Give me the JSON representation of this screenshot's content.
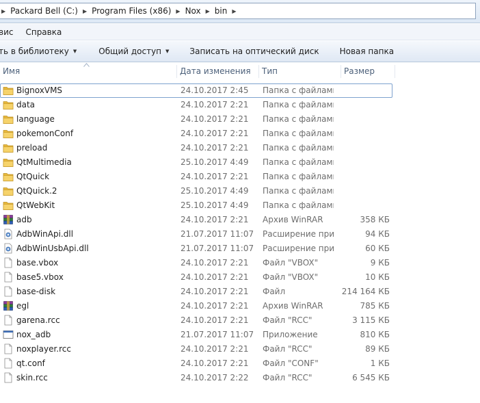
{
  "address": {
    "crumbs": [
      "Packard Bell (C:)",
      "Program Files (x86)",
      "Nox",
      "bin"
    ]
  },
  "menubar": {
    "items": [
      "вис",
      "Справка"
    ]
  },
  "toolbar": {
    "library_label": "ть в библиотеку",
    "share_label": "Общий доступ",
    "burn_label": "Записать на оптический диск",
    "new_folder_label": "Новая папка"
  },
  "columns": {
    "name": "Имя",
    "date": "Дата изменения",
    "type": "Тип",
    "size": "Размер"
  },
  "files": [
    {
      "name": "BignoxVMS",
      "date": "24.10.2017 2:45",
      "type": "Папка с файлами",
      "size": "",
      "icon": "folder-icon"
    },
    {
      "name": "data",
      "date": "24.10.2017 2:21",
      "type": "Папка с файлами",
      "size": "",
      "icon": "folder-icon"
    },
    {
      "name": "language",
      "date": "24.10.2017 2:21",
      "type": "Папка с файлами",
      "size": "",
      "icon": "folder-icon"
    },
    {
      "name": "pokemonConf",
      "date": "24.10.2017 2:21",
      "type": "Папка с файлами",
      "size": "",
      "icon": "folder-icon"
    },
    {
      "name": "preload",
      "date": "24.10.2017 2:21",
      "type": "Папка с файлами",
      "size": "",
      "icon": "folder-icon"
    },
    {
      "name": "QtMultimedia",
      "date": "25.10.2017 4:49",
      "type": "Папка с файлами",
      "size": "",
      "icon": "folder-icon"
    },
    {
      "name": "QtQuick",
      "date": "24.10.2017 2:21",
      "type": "Папка с файлами",
      "size": "",
      "icon": "folder-icon"
    },
    {
      "name": "QtQuick.2",
      "date": "25.10.2017 4:49",
      "type": "Папка с файлами",
      "size": "",
      "icon": "folder-icon"
    },
    {
      "name": "QtWebKit",
      "date": "25.10.2017 4:49",
      "type": "Папка с файлами",
      "size": "",
      "icon": "folder-icon"
    },
    {
      "name": "adb",
      "date": "24.10.2017 2:21",
      "type": "Архив WinRAR",
      "size": "358 КБ",
      "icon": "winrar-icon"
    },
    {
      "name": "AdbWinApi.dll",
      "date": "21.07.2017 11:07",
      "type": "Расширение при...",
      "size": "94 КБ",
      "icon": "dll-icon"
    },
    {
      "name": "AdbWinUsbApi.dll",
      "date": "21.07.2017 11:07",
      "type": "Расширение при...",
      "size": "60 КБ",
      "icon": "dll-icon"
    },
    {
      "name": "base.vbox",
      "date": "24.10.2017 2:21",
      "type": "Файл \"VBOX\"",
      "size": "9 КБ",
      "icon": "file-icon"
    },
    {
      "name": "base5.vbox",
      "date": "24.10.2017 2:21",
      "type": "Файл \"VBOX\"",
      "size": "10 КБ",
      "icon": "file-icon"
    },
    {
      "name": "base-disk",
      "date": "24.10.2017 2:21",
      "type": "Файл",
      "size": "214 164 КБ",
      "icon": "file-icon"
    },
    {
      "name": "egl",
      "date": "24.10.2017 2:21",
      "type": "Архив WinRAR",
      "size": "785 КБ",
      "icon": "winrar-icon"
    },
    {
      "name": "garena.rcc",
      "date": "24.10.2017 2:21",
      "type": "Файл \"RCC\"",
      "size": "3 115 КБ",
      "icon": "file-icon"
    },
    {
      "name": "nox_adb",
      "date": "21.07.2017 11:07",
      "type": "Приложение",
      "size": "810 КБ",
      "icon": "exe-icon"
    },
    {
      "name": "noxplayer.rcc",
      "date": "24.10.2017 2:21",
      "type": "Файл \"RCC\"",
      "size": "89 КБ",
      "icon": "file-icon"
    },
    {
      "name": "qt.conf",
      "date": "24.10.2017 2:21",
      "type": "Файл \"CONF\"",
      "size": "1 КБ",
      "icon": "file-icon"
    },
    {
      "name": "skin.rcc",
      "date": "24.10.2017 2:22",
      "type": "Файл \"RCC\"",
      "size": "6 545 КБ",
      "icon": "file-icon"
    }
  ]
}
